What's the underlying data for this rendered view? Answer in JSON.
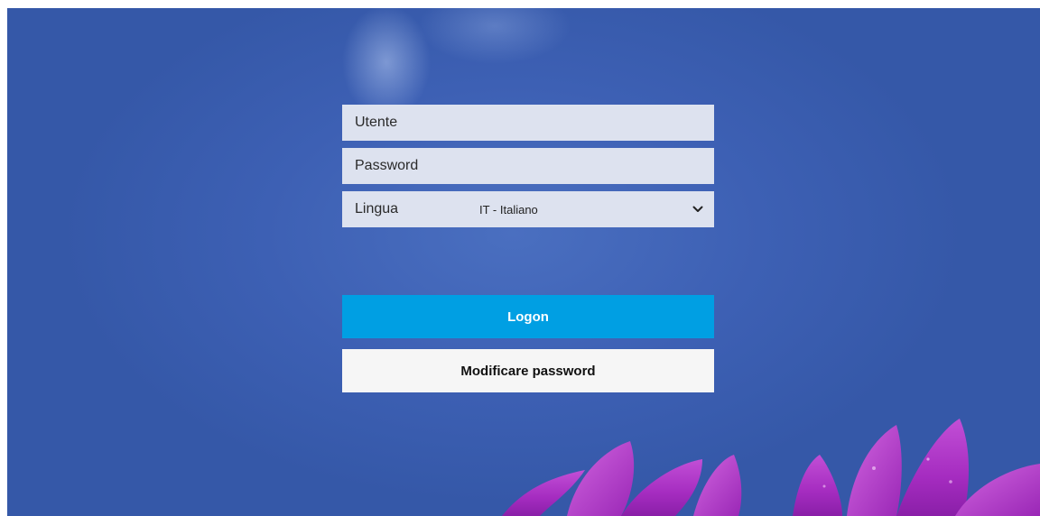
{
  "login_form": {
    "user_placeholder": "Utente",
    "user_value": "",
    "password_placeholder": "Password",
    "password_value": "",
    "language_label": "Lingua",
    "language_selected": "IT - Italiano",
    "language_icon": "chevron-down-icon",
    "logon_label": "Logon",
    "change_password_label": "Modificare password"
  },
  "colors": {
    "background": "#3d60b4",
    "field_background": "#dde2ef",
    "primary_button": "#009fe3",
    "secondary_button": "#f6f6f6",
    "flower": "#b030c8"
  },
  "decor": {
    "background_image": "blue-sky-with-purple-flower"
  }
}
